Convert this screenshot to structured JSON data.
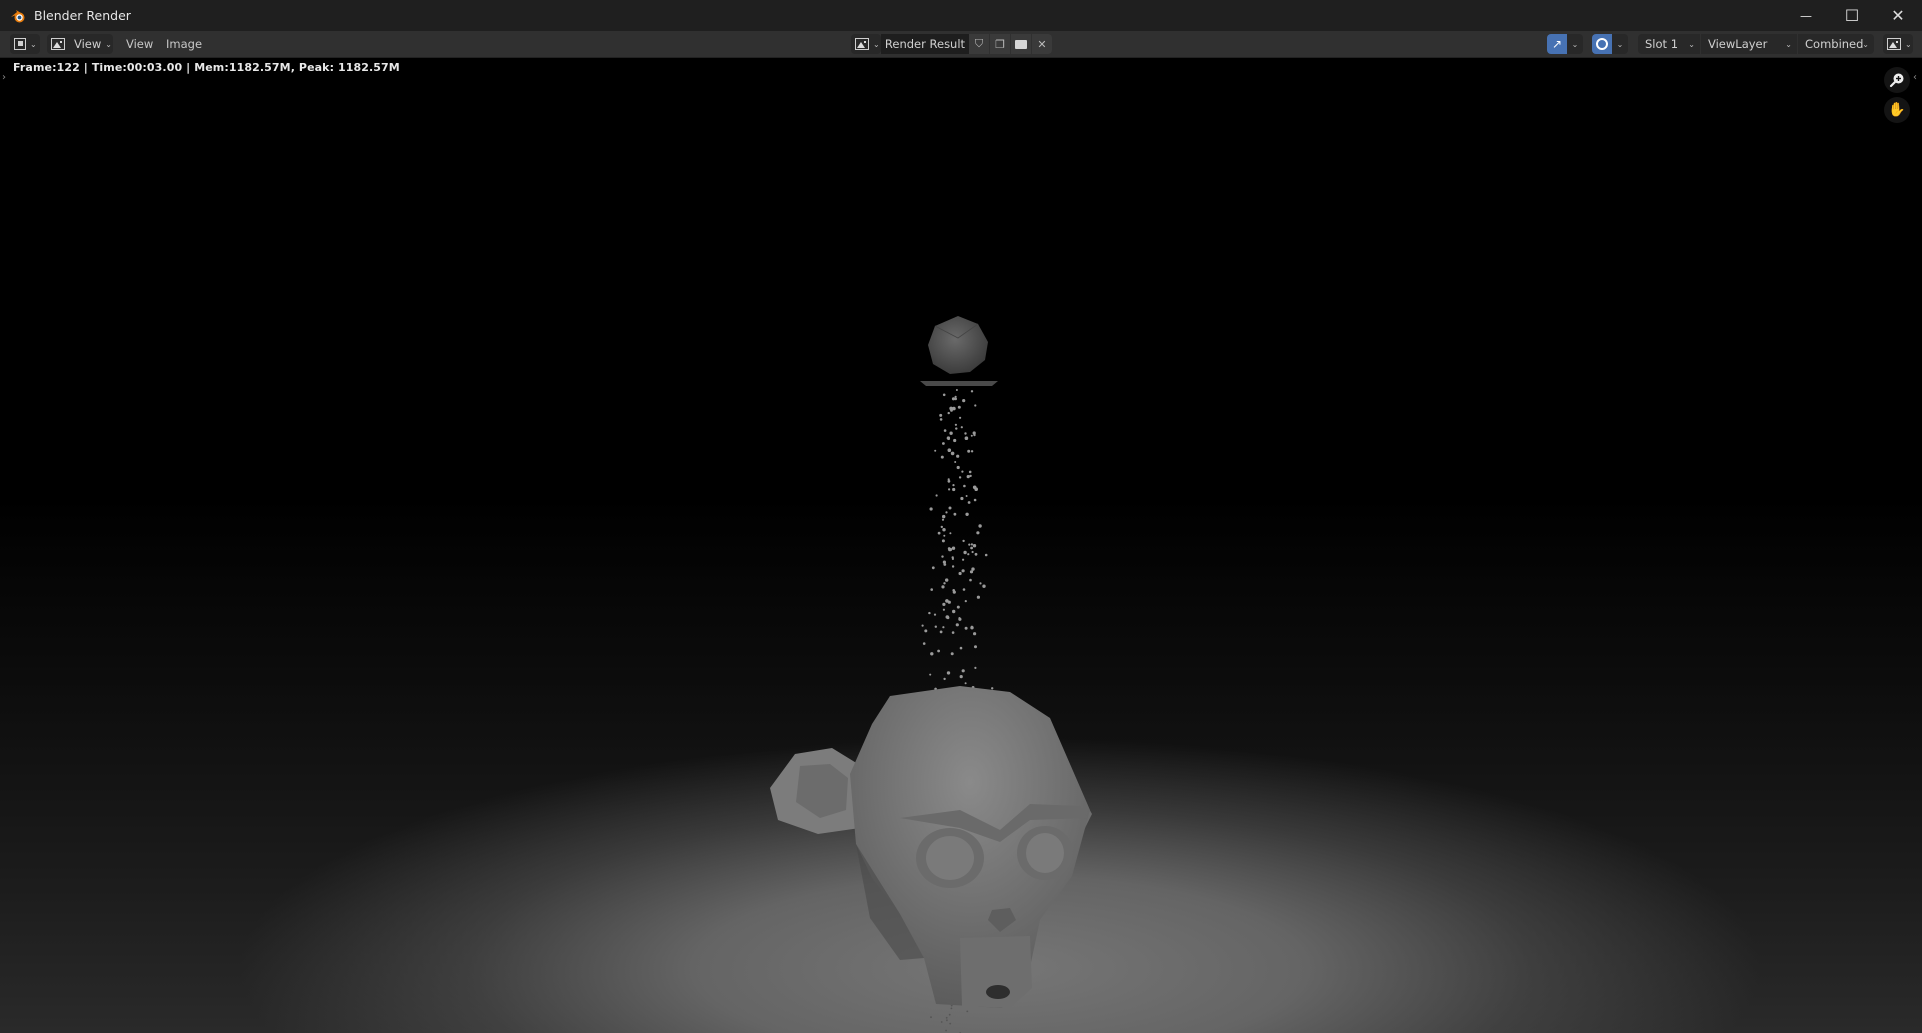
{
  "window": {
    "title": "Blender Render",
    "controls": {
      "minimize": "—",
      "maximize": "☐",
      "close": "✕"
    }
  },
  "header": {
    "editor_type_icon": "image-editor-icon",
    "view_mode_label": "View",
    "menus": [
      "View",
      "Image"
    ],
    "image_browse_icon": "image-icon",
    "image_name": "Render Result",
    "fake_user_icon": "shield-icon",
    "duplicate_icon": "duplicate-icon",
    "open_icon": "folder-icon",
    "unlink_icon": "close-icon",
    "gizmo_toggle_icon": "gizmo-icon",
    "overlay_toggle_icon": "overlay-icon",
    "slot": "Slot 1",
    "view_layer": "ViewLayer",
    "pass": "Combined",
    "display_channels_icon": "display-channels-icon"
  },
  "info": {
    "stats": "Frame:122 | Time:00:03.00 | Mem:1182.57M, Peak: 1182.57M"
  },
  "navigation": {
    "zoom_icon": "zoom-icon",
    "pan_icon": "hand-icon"
  },
  "colors": {
    "accent": "#4772b3",
    "logo_orange": "#e87d0d",
    "logo_blue": "#265787",
    "header_bg": "#303030",
    "titlebar_bg": "#1f1f1f"
  }
}
